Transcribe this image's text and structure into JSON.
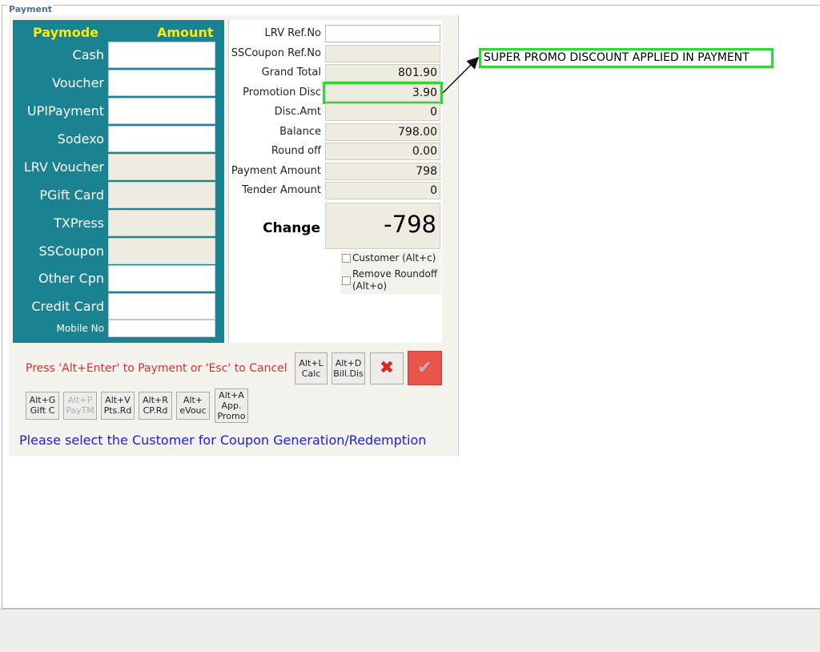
{
  "window": {
    "title": "Payment"
  },
  "paymode": {
    "header_mode": "Paymode",
    "header_amount": "Amount",
    "rows": [
      {
        "label": "Cash",
        "value": "",
        "enabled": true
      },
      {
        "label": "Voucher",
        "value": "",
        "enabled": true
      },
      {
        "label": "UPIPayment",
        "value": "",
        "enabled": true
      },
      {
        "label": "Sodexo",
        "value": "",
        "enabled": true
      },
      {
        "label": "LRV Voucher",
        "value": "",
        "enabled": false
      },
      {
        "label": "PGift Card",
        "value": "",
        "enabled": false
      },
      {
        "label": "TXPress",
        "value": "",
        "enabled": false
      },
      {
        "label": "SSCoupon",
        "value": "",
        "enabled": false
      },
      {
        "label": "Other Cpn",
        "value": "",
        "enabled": true
      },
      {
        "label": "Credit Card",
        "value": "",
        "enabled": true
      }
    ],
    "mobile_label": "Mobile No",
    "mobile_value": ""
  },
  "summary": {
    "lrv_ref_label": "LRV Ref.No",
    "lrv_ref_value": "",
    "sscoupon_ref_label": "SSCoupon Ref.No",
    "sscoupon_ref_value": "",
    "grand_total_label": "Grand Total",
    "grand_total_value": "801.90",
    "promotion_disc_label": "Promotion Disc",
    "promotion_disc_value": "3.90",
    "disc_amt_label": "Disc.Amt",
    "disc_amt_value": "0",
    "balance_label": "Balance",
    "balance_value": "798.00",
    "round_off_label": "Round off",
    "round_off_value": "0.00",
    "payment_amount_label": "Payment Amount",
    "payment_amount_value": "798",
    "tender_amount_label": "Tender Amount",
    "tender_amount_value": "0",
    "change_label": "Change",
    "change_value": "-798"
  },
  "options": {
    "customer_label": "Customer (Alt+c)",
    "remove_roundoff_label_1": "Remove Roundoff",
    "remove_roundoff_label_2": "(Alt+o)"
  },
  "actions": {
    "hint": "Press 'Alt+Enter' to Payment or 'Esc' to Cancel",
    "calc_top": "Alt+L",
    "calc_bottom": "Calc",
    "billdis_top": "Alt+D",
    "billdis_bottom": "Bill.Dis",
    "cancel_icon": "✖",
    "ok_icon": "✔",
    "giftc_top": "Alt+G",
    "giftc_bottom": "Gift C",
    "paytm_top": "Alt+P",
    "paytm_bottom": "PayTM",
    "ptsrd_top": "Alt+V",
    "ptsrd_bottom": "Pts.Rd",
    "cprd_top": "Alt+R",
    "cprd_bottom": "CP.Rd",
    "evouc_top": "Alt+",
    "evouc_bottom": "eVouc",
    "promo_top": "Alt+A",
    "promo_mid": "App.",
    "promo_bottom": "Promo"
  },
  "notice": "Please select the Customer for Coupon Generation/Redemption",
  "callout": "SUPER PROMO DISCOUNT APPLIED IN PAYMENT",
  "colors": {
    "panel": "#1b8291",
    "header_text": "#ffeb00",
    "highlight": "#35d43a",
    "hint": "#d9312d",
    "notice": "#1b22d8"
  }
}
